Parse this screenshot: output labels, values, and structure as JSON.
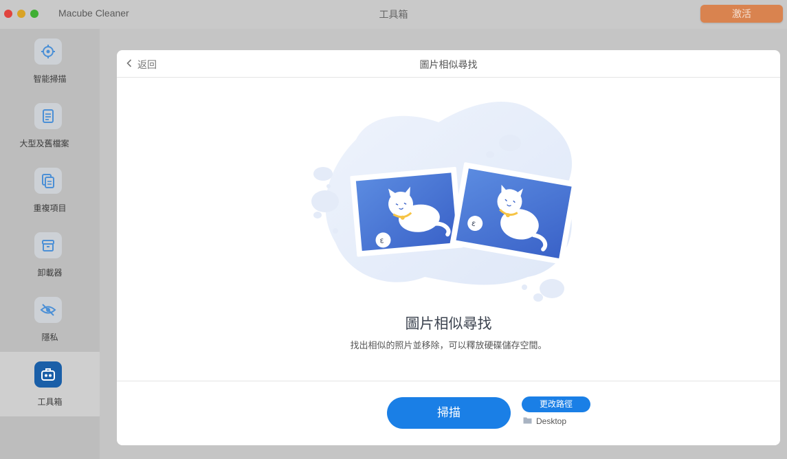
{
  "app": {
    "name": "Macube Cleaner",
    "window_title": "工具箱",
    "activate_label": "激活"
  },
  "sidebar": {
    "items": [
      {
        "label": "智能掃描",
        "icon": "target-icon"
      },
      {
        "label": "大型及舊檔案",
        "icon": "document-icon"
      },
      {
        "label": "重複項目",
        "icon": "duplicate-icon"
      },
      {
        "label": "卸載器",
        "icon": "box-icon"
      },
      {
        "label": "隱私",
        "icon": "eye-slash-icon"
      },
      {
        "label": "工具箱",
        "icon": "toolbox-icon",
        "active": true
      }
    ]
  },
  "panel": {
    "back_label": "返回",
    "title": "圖片相似尋找",
    "feature_title": "圖片相似尋找",
    "feature_description": "找出相似的照片並移除，可以釋放硬碟儲存空間。",
    "scan_label": "掃描",
    "change_path_label": "更改路徑",
    "path_value": "Desktop"
  },
  "colors": {
    "accent": "#1a7fe6",
    "activate": "#d9834f",
    "active_sidebar_icon": "#1a5fa8"
  }
}
